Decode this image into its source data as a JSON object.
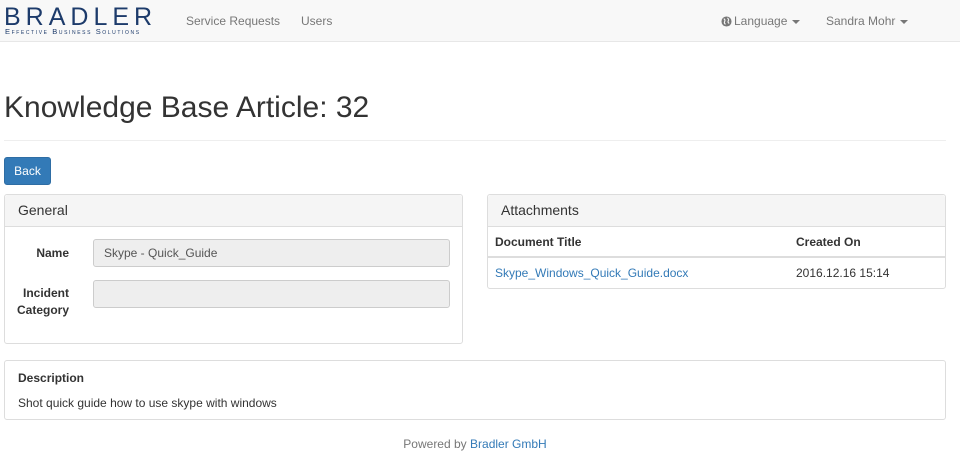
{
  "brand": {
    "name": "BRADLER",
    "tagline": "Effective Business Solutions"
  },
  "nav": {
    "links": [
      "Service Requests",
      "Users"
    ],
    "language": "Language",
    "user": "Sandra Mohr"
  },
  "page": {
    "title": "Knowledge Base Article: 32",
    "back_label": "Back"
  },
  "general": {
    "heading": "General",
    "name_label": "Name",
    "name_value": "Skype - Quick_Guide",
    "category_label_1": "Incident",
    "category_label_2": "Category",
    "category_value": ""
  },
  "attachments": {
    "heading": "Attachments",
    "columns": [
      "Document Title",
      "Created On"
    ],
    "rows": [
      {
        "title": "Skype_Windows_Quick_Guide.docx",
        "created": "2016.12.16 15:14"
      }
    ]
  },
  "description": {
    "label": "Description",
    "text": "Shot quick guide how to use skype with windows"
  },
  "footer": {
    "prefix": "Powered by",
    "company": "Bradler GmbH"
  },
  "colors": {
    "primary": "#337ab7",
    "brand": "#1d3b6b",
    "navbar_bg": "#f8f8f8"
  }
}
